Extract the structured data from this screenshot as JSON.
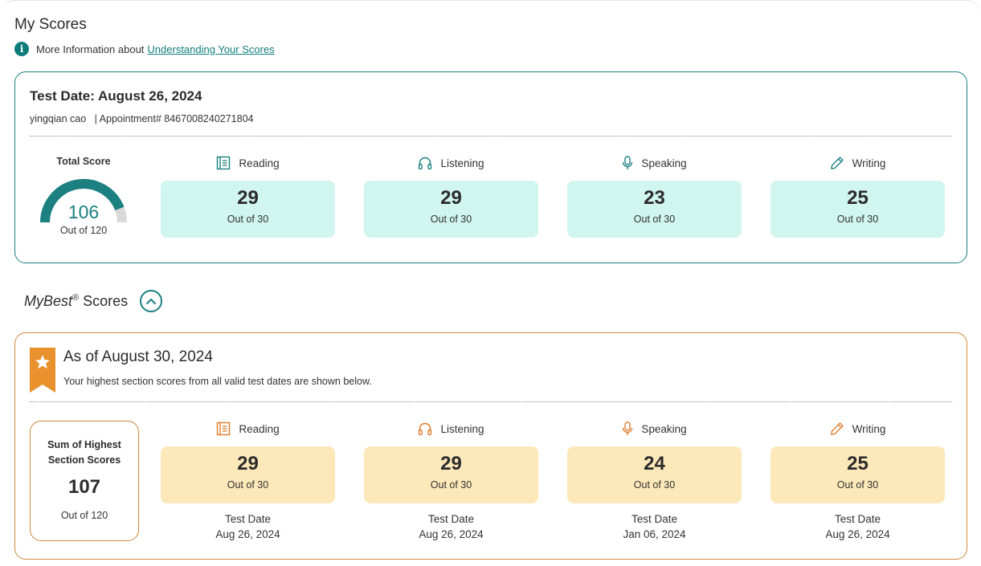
{
  "page": {
    "title": "My Scores",
    "info_text": "More Information about",
    "info_link": "Understanding Your Scores"
  },
  "test": {
    "date_label": "Test Date: August 26, 2024",
    "candidate": "yingqian cao",
    "appointment": "| Appointment# 8467008240271804",
    "total": {
      "label": "Total Score",
      "value": "106",
      "out_of": "Out of 120",
      "fraction": 0.8833
    },
    "sections": [
      {
        "name": "Reading",
        "icon": "book-icon",
        "score": "29",
        "out_of": "Out of 30"
      },
      {
        "name": "Listening",
        "icon": "headphones-icon",
        "score": "29",
        "out_of": "Out of 30"
      },
      {
        "name": "Speaking",
        "icon": "microphone-icon",
        "score": "23",
        "out_of": "Out of 30"
      },
      {
        "name": "Writing",
        "icon": "pencil-icon",
        "score": "25",
        "out_of": "Out of 30"
      }
    ]
  },
  "mybest": {
    "title_italic": "MyBest",
    "title_reg": "®",
    "title_rest": " Scores",
    "as_of": "As of August 30, 2024",
    "subtitle": "Your highest section scores from all valid test dates are shown below.",
    "sum": {
      "label": "Sum of Highest Section Scores",
      "value": "107",
      "out_of": "Out of 120"
    },
    "test_date_label": "Test Date",
    "sections": [
      {
        "name": "Reading",
        "icon": "book-icon",
        "score": "29",
        "out_of": "Out of 30",
        "date": "Aug 26, 2024"
      },
      {
        "name": "Listening",
        "icon": "headphones-icon",
        "score": "29",
        "out_of": "Out of 30",
        "date": "Aug 26, 2024"
      },
      {
        "name": "Speaking",
        "icon": "microphone-icon",
        "score": "24",
        "out_of": "Out of 30",
        "date": "Jan 06, 2024"
      },
      {
        "name": "Writing",
        "icon": "pencil-icon",
        "score": "25",
        "out_of": "Out of 30",
        "date": "Aug 26, 2024"
      }
    ]
  },
  "colors": {
    "teal": "#1c7f80",
    "teal_fill": "#d1f5ef",
    "amber": "#d08a3a",
    "amber_fill": "#fde8b9",
    "ribbon": "#e8912d"
  }
}
